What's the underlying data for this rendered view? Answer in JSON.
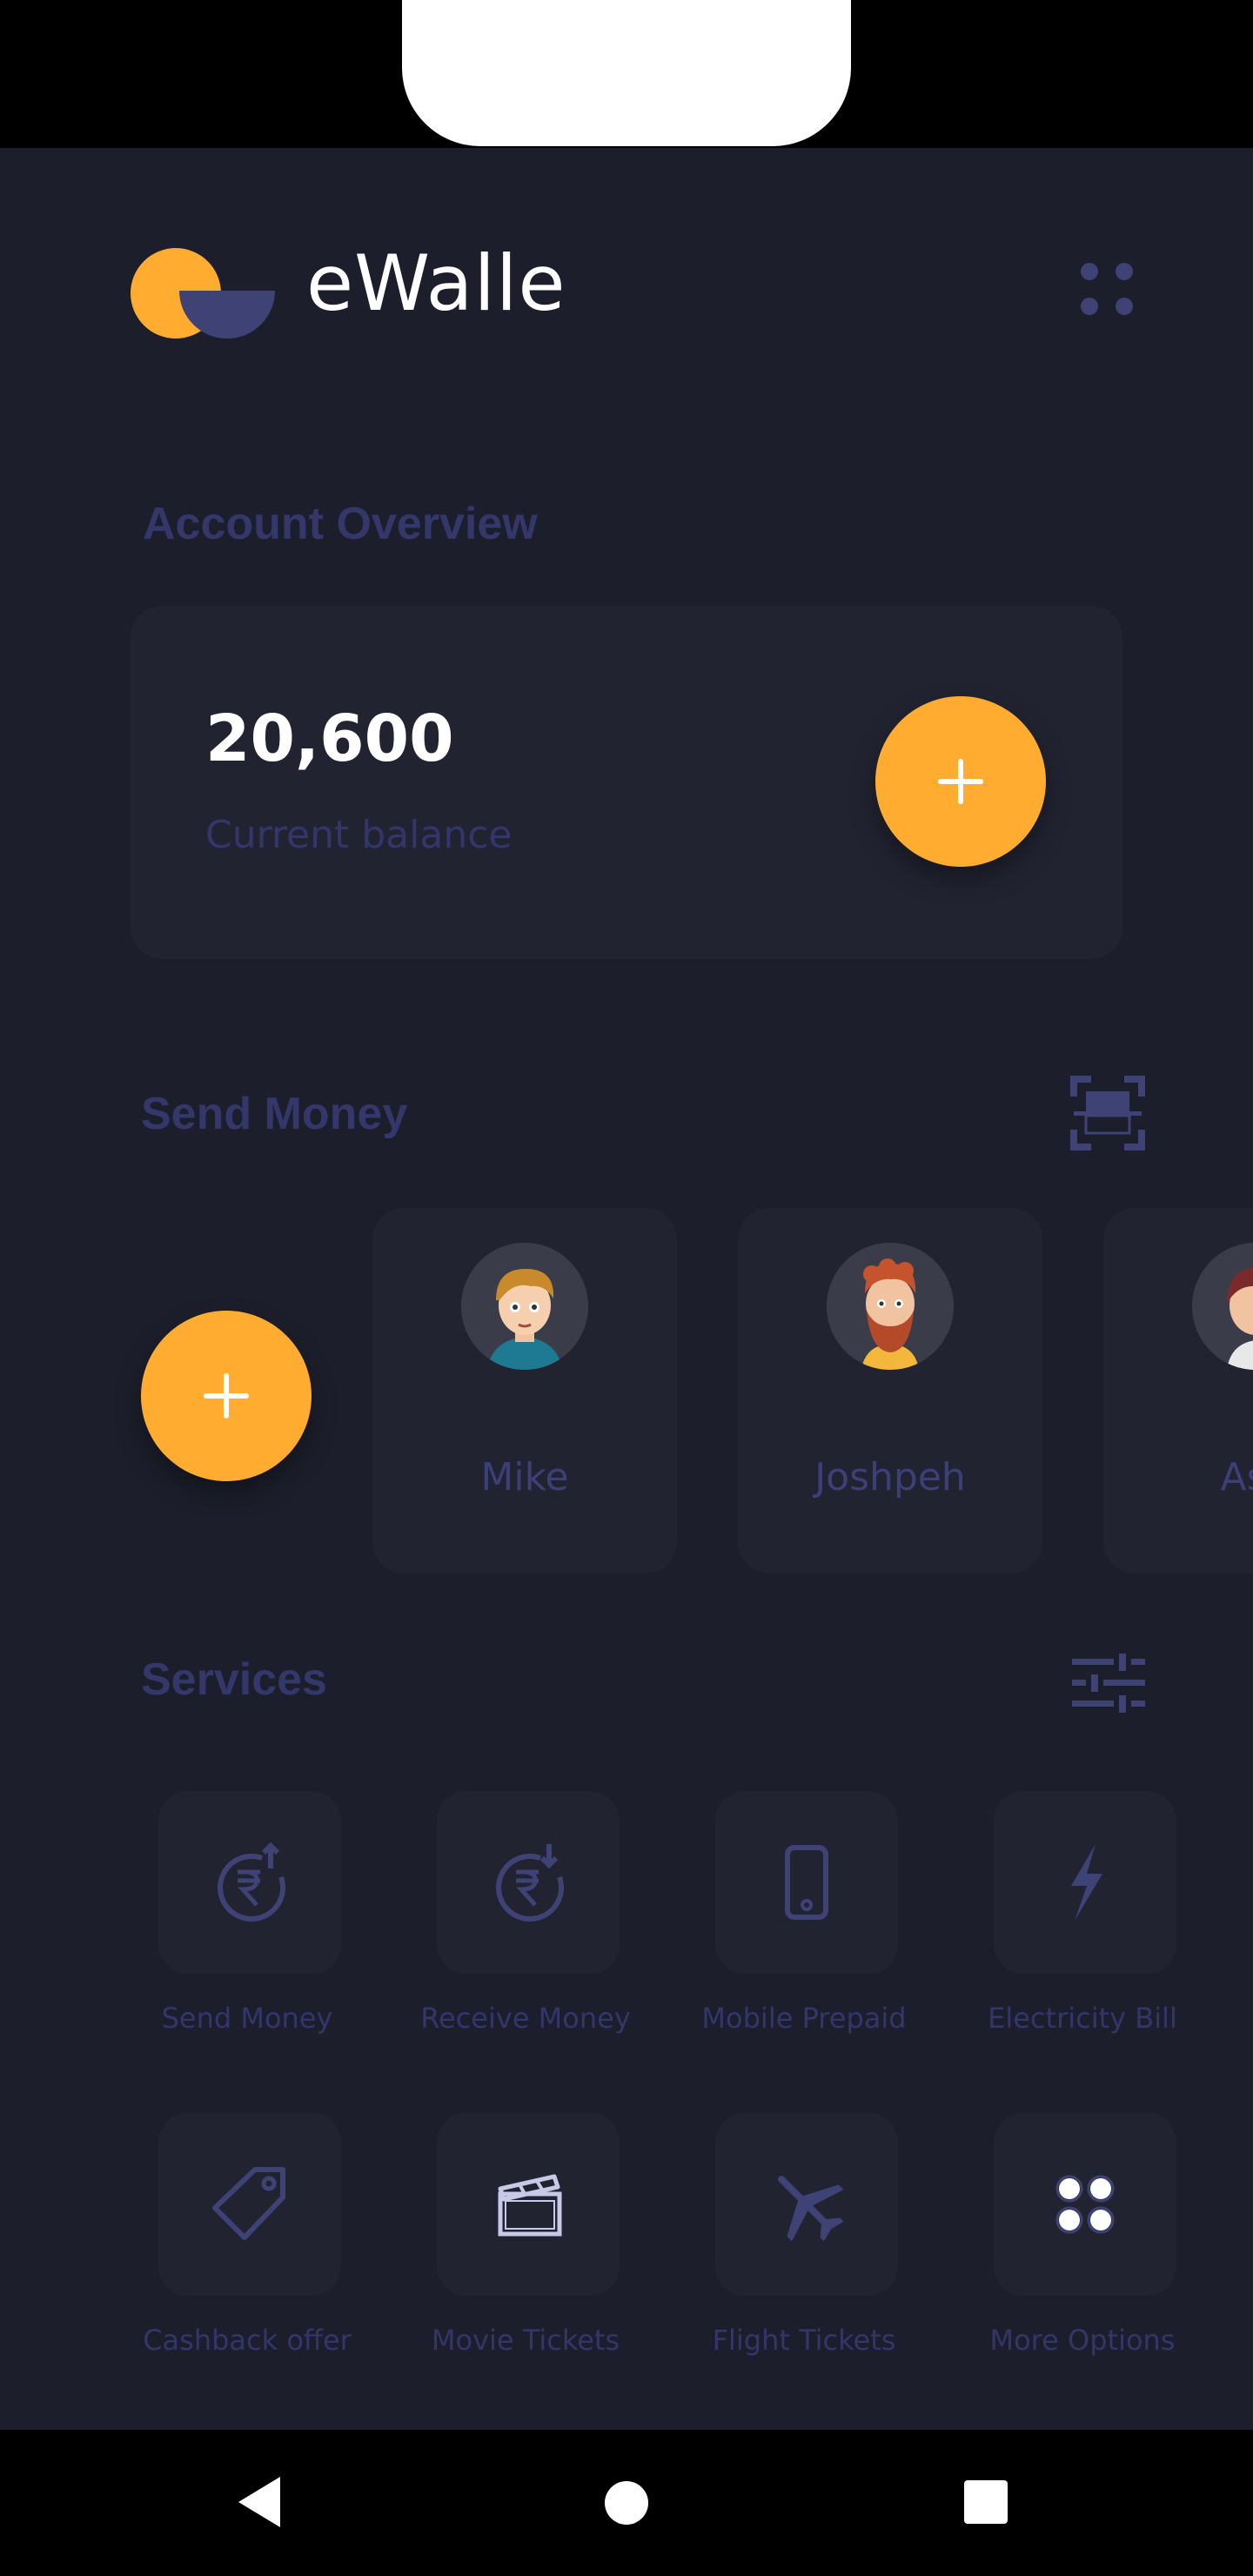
{
  "app": {
    "brand": "eWalle"
  },
  "account": {
    "section_title": "Account Overview",
    "balance": "20,600",
    "balance_label": "Current balance"
  },
  "send_money": {
    "section_title": "Send Money",
    "contacts": [
      {
        "name": "Mike"
      },
      {
        "name": "Joshpeh"
      },
      {
        "name": "Ash"
      }
    ]
  },
  "services": {
    "section_title": "Services",
    "items": [
      {
        "label": "Send Money",
        "icon": "rupee-send-icon"
      },
      {
        "label": "Receive Money",
        "icon": "rupee-receive-icon"
      },
      {
        "label": "Mobile Prepaid",
        "icon": "mobile-icon"
      },
      {
        "label": "Electricity Bill",
        "icon": "lightning-icon"
      },
      {
        "label": "Cashback offer",
        "icon": "tag-icon"
      },
      {
        "label": "Movie Tickets",
        "icon": "clapperboard-icon"
      },
      {
        "label": "Flight Tickets",
        "icon": "airplane-icon"
      },
      {
        "label": "More Options",
        "icon": "grid-dots-icon"
      }
    ]
  },
  "colors": {
    "background": "#1c1e2b",
    "card": "#212331",
    "accent": "#ffac30",
    "muted_text": "#33366a",
    "icon": "#3f4275"
  }
}
